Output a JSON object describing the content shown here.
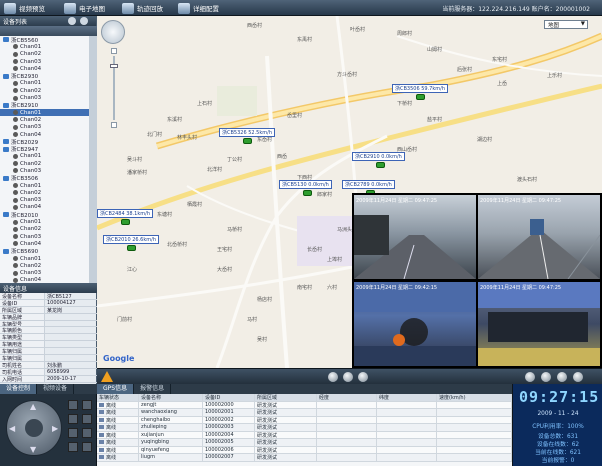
{
  "nav": {
    "items": [
      {
        "label": "视频预览",
        "icon": "video-preview-icon"
      },
      {
        "label": "电子地图",
        "icon": "map-icon"
      },
      {
        "label": "轨迹回放",
        "icon": "track-playback-icon"
      },
      {
        "label": "详细配置",
        "icon": "settings-icon"
      }
    ],
    "server_info": "当前服务器：122.224.216.149  账户名：200001002"
  },
  "left": {
    "device_header": "设备列表",
    "tree": [
      {
        "label": "浙CB5560",
        "type": "vehicle"
      },
      {
        "label": "Chan01",
        "type": "channel"
      },
      {
        "label": "Chan02",
        "type": "channel"
      },
      {
        "label": "Chan03",
        "type": "channel"
      },
      {
        "label": "Chan04",
        "type": "channel"
      },
      {
        "label": "浙CB2930",
        "type": "vehicle"
      },
      {
        "label": "Chan01",
        "type": "channel"
      },
      {
        "label": "Chan02",
        "type": "channel"
      },
      {
        "label": "Chan03",
        "type": "channel"
      },
      {
        "label": "浙CB2910",
        "type": "vehicle"
      },
      {
        "label": "Chan01",
        "type": "channel",
        "selected": true
      },
      {
        "label": "Chan02",
        "type": "channel"
      },
      {
        "label": "Chan03",
        "type": "channel"
      },
      {
        "label": "Chan04",
        "type": "channel"
      },
      {
        "label": "浙CB2029",
        "type": "vehicle"
      },
      {
        "label": "浙CB2947",
        "type": "vehicle"
      },
      {
        "label": "Chan01",
        "type": "channel"
      },
      {
        "label": "Chan02",
        "type": "channel"
      },
      {
        "label": "Chan03",
        "type": "channel"
      },
      {
        "label": "浙CB3506",
        "type": "vehicle"
      },
      {
        "label": "Chan01",
        "type": "channel"
      },
      {
        "label": "Chan02",
        "type": "channel"
      },
      {
        "label": "Chan03",
        "type": "channel"
      },
      {
        "label": "Chan04",
        "type": "channel"
      },
      {
        "label": "浙CB2010",
        "type": "vehicle"
      },
      {
        "label": "Chan01",
        "type": "channel"
      },
      {
        "label": "Chan02",
        "type": "channel"
      },
      {
        "label": "Chan03",
        "type": "channel"
      },
      {
        "label": "Chan04",
        "type": "channel"
      },
      {
        "label": "浙CB5690",
        "type": "vehicle"
      },
      {
        "label": "Chan01",
        "type": "channel"
      },
      {
        "label": "Chan02",
        "type": "channel"
      },
      {
        "label": "Chan03",
        "type": "channel"
      },
      {
        "label": "Chan04",
        "type": "channel"
      }
    ],
    "info_header": "设备信息",
    "info_rows": [
      {
        "k": "设备名称",
        "v": "浙CB5127"
      },
      {
        "k": "设备ID",
        "v": "100004127"
      },
      {
        "k": "所属区域",
        "v": "某龙岗"
      },
      {
        "k": "车辆品牌",
        "v": ""
      },
      {
        "k": "车辆型号",
        "v": ""
      },
      {
        "k": "车辆颜色",
        "v": ""
      },
      {
        "k": "车辆类型",
        "v": ""
      },
      {
        "k": "车辆用途",
        "v": ""
      },
      {
        "k": "车辆归属",
        "v": ""
      },
      {
        "k": "车辆归属",
        "v": ""
      },
      {
        "k": "司机姓名",
        "v": "刘永鹏"
      },
      {
        "k": "司机电话",
        "v": "6058999"
      },
      {
        "k": "入网时间",
        "v": "2009-10-17"
      }
    ]
  },
  "map": {
    "type_select": "地图",
    "labels": [
      "西岙村",
      "东禹村",
      "叶岙村",
      "周郎村",
      "山姆村",
      "东宅村",
      "后张村",
      "方斗岙村",
      "上乐村",
      "上岙",
      "上石村",
      "东溪村",
      "岙里村",
      "下桥村",
      "盐平村",
      "北门村",
      "林丰头村",
      "吴斗村",
      "湖边村",
      "潘家桥村",
      "东岙村",
      "丁公村",
      "北洋村",
      "西岙",
      "下西村",
      "西山岙村",
      "渡头石村",
      "郎家村",
      "栖霞村",
      "东塘村",
      "马桥村",
      "马洲头村",
      "北岙桥村",
      "江心",
      "大岙村",
      "门前村",
      "马村",
      "长岙村",
      "上埠村",
      "王宅村",
      "杨店村",
      "南宅村",
      "吴村",
      "六村"
    ],
    "vehicles": [
      {
        "tag": "浙CB5326 52.5km/h"
      },
      {
        "tag": "浙CB3506 59.7km/h"
      },
      {
        "tag": "浙CB2910 0.0km/h"
      },
      {
        "tag": "浙CB5130 0.0km/h"
      },
      {
        "tag": "浙CB2789 0.0km/h"
      },
      {
        "tag": "浙CB2484 38.1km/h"
      },
      {
        "tag": "浙CB2010 26.6km/h"
      }
    ],
    "logo": "Google"
  },
  "video": {
    "cells": [
      {
        "osd": "2009年11月24日  星期二  09:47:25",
        "cam": "CAM 01"
      },
      {
        "osd": "2009年11月24日  星期二  09:47:25",
        "cam": "CAM 02"
      },
      {
        "osd": "2009年11月24日  星期二  09:42:15",
        "cam": "CAM 03"
      },
      {
        "osd": "2009年11月24日  星期二  09:47:25",
        "cam": "CAM 04"
      }
    ]
  },
  "bottom": {
    "ptz_header": "设备控制",
    "ptz_tab2": "视频设备",
    "tabs": [
      "GPS信息",
      "报警信息"
    ],
    "columns": [
      "车辆状态",
      "设备名称",
      "设备ID",
      "所属区域",
      "经度",
      "纬度",
      "速度(km/h)"
    ],
    "rows": [
      [
        "离线",
        "zengjt",
        "100002000",
        "研发测试",
        "",
        "",
        ""
      ],
      [
        "离线",
        "wanchaoxiang",
        "100002001",
        "研发测试",
        "",
        "",
        ""
      ],
      [
        "离线",
        "chenghaibo",
        "100002002",
        "研发测试",
        "",
        "",
        ""
      ],
      [
        "离线",
        "zhulieping",
        "100002003",
        "研发测试",
        "",
        "",
        ""
      ],
      [
        "离线",
        "xujianjun",
        "100002004",
        "研发测试",
        "",
        "",
        ""
      ],
      [
        "离线",
        "yuqingbing",
        "100002005",
        "研发测试",
        "",
        "",
        ""
      ],
      [
        "离线",
        "qinyuefeng",
        "100002006",
        "研发测试",
        "",
        "",
        ""
      ],
      [
        "离线",
        "liugm",
        "100002007",
        "研发测试",
        "",
        "",
        ""
      ]
    ],
    "clock": "09:27:15",
    "date": "2009 - 11 - 24",
    "cpu": "CPU利用率：100%",
    "stats": [
      "设备总数：631",
      "设备在线数：62",
      "当前在线数：621",
      "当前报警：0"
    ]
  }
}
